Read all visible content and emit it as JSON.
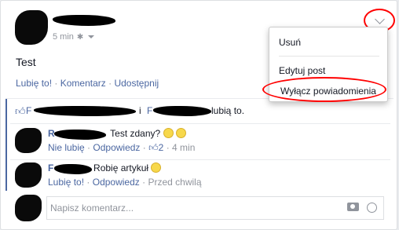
{
  "post": {
    "time": "5 min",
    "privacy_icon": "gear-icon",
    "text": "Test",
    "actions": {
      "like": "Lubię to!",
      "comment": "Komentarz",
      "share": "Udostępnij",
      "sep": "·"
    }
  },
  "likes": {
    "prefix": "F",
    "middle": "i",
    "middle_prefix": "F",
    "suffix": "lubią to."
  },
  "comments": [
    {
      "name_prefix": "R",
      "text": "Test zdany?",
      "actions": {
        "unlike": "Nie lubię",
        "reply": "Odpowiedz",
        "like_count": "2",
        "time": "4 min",
        "sep": "·"
      }
    },
    {
      "name_prefix": "F",
      "text": "Robię artykuł",
      "actions": {
        "like": "Lubię to!",
        "reply": "Odpowiedz",
        "time": "Przed chwilą",
        "sep": "·"
      }
    }
  ],
  "composer": {
    "placeholder": "Napisz komentarz..."
  },
  "menu": {
    "items": [
      "Usuń",
      "Edytuj post",
      "Wyłącz powiadomienia"
    ]
  },
  "colors": {
    "link": "#4b67a1",
    "highlight": "#ff0000",
    "muted": "#90949c"
  }
}
